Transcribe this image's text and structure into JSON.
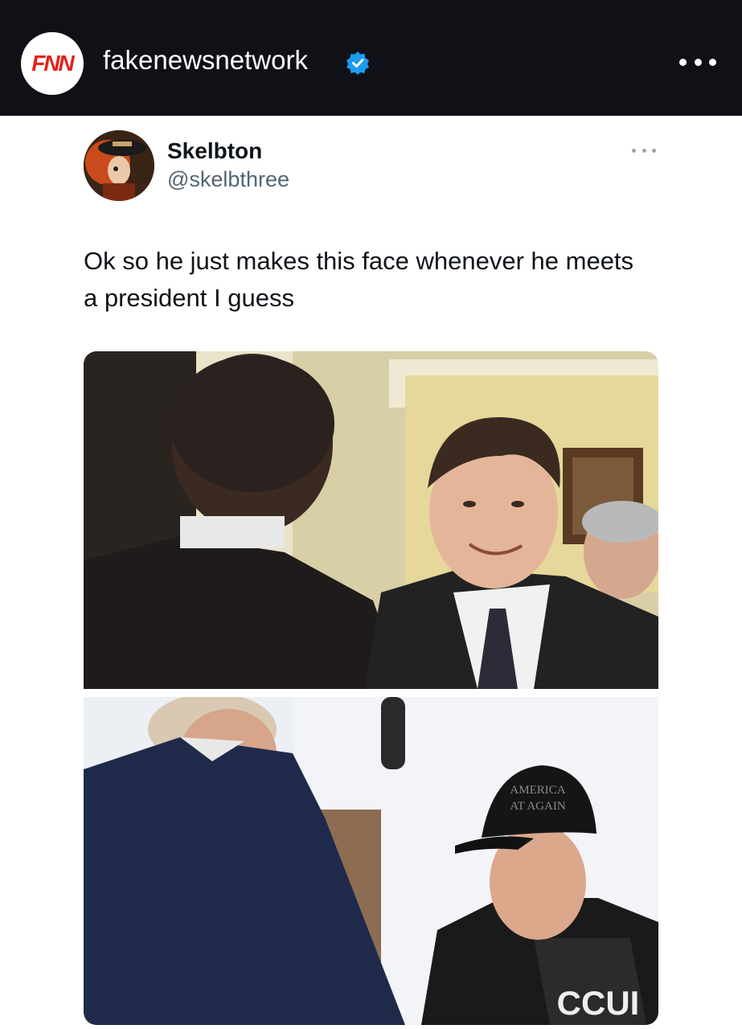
{
  "header": {
    "logo_text": "FNN",
    "account_name": "fakenewsnetwork",
    "verified": true,
    "more_icon": "more-horizontal-icon"
  },
  "tweet": {
    "author_name": "Skelbton",
    "author_handle": "@skelbthree",
    "text": "Ok so he just makes this face whenever he meets a president I guess",
    "more_icon": "more-horizontal-icon"
  },
  "images": [
    {
      "name": "photo-top"
    },
    {
      "name": "photo-bottom",
      "cap_text_line1": "AMERICA",
      "cap_text_line2": "AT AGAIN",
      "shirt_text": "CCUI"
    }
  ],
  "colors": {
    "header_bg": "#0f1117",
    "verified_blue": "#1d9bf0",
    "brand_red": "#e3231b"
  }
}
